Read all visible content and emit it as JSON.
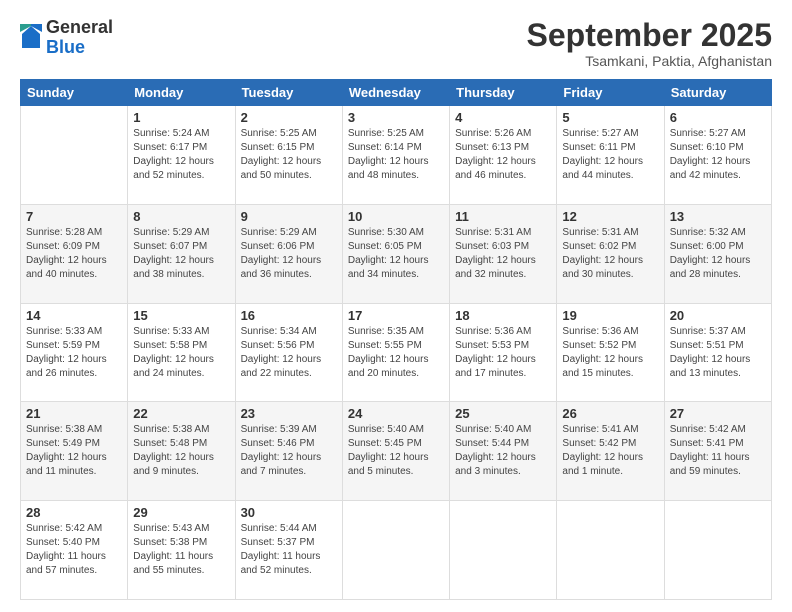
{
  "logo": {
    "general": "General",
    "blue": "Blue"
  },
  "title": "September 2025",
  "subtitle": "Tsamkani, Paktia, Afghanistan",
  "headers": [
    "Sunday",
    "Monday",
    "Tuesday",
    "Wednesday",
    "Thursday",
    "Friday",
    "Saturday"
  ],
  "weeks": [
    [
      {
        "day": "",
        "sunrise": "",
        "sunset": "",
        "daylight": ""
      },
      {
        "day": "1",
        "sunrise": "Sunrise: 5:24 AM",
        "sunset": "Sunset: 6:17 PM",
        "daylight": "Daylight: 12 hours and 52 minutes."
      },
      {
        "day": "2",
        "sunrise": "Sunrise: 5:25 AM",
        "sunset": "Sunset: 6:15 PM",
        "daylight": "Daylight: 12 hours and 50 minutes."
      },
      {
        "day": "3",
        "sunrise": "Sunrise: 5:25 AM",
        "sunset": "Sunset: 6:14 PM",
        "daylight": "Daylight: 12 hours and 48 minutes."
      },
      {
        "day": "4",
        "sunrise": "Sunrise: 5:26 AM",
        "sunset": "Sunset: 6:13 PM",
        "daylight": "Daylight: 12 hours and 46 minutes."
      },
      {
        "day": "5",
        "sunrise": "Sunrise: 5:27 AM",
        "sunset": "Sunset: 6:11 PM",
        "daylight": "Daylight: 12 hours and 44 minutes."
      },
      {
        "day": "6",
        "sunrise": "Sunrise: 5:27 AM",
        "sunset": "Sunset: 6:10 PM",
        "daylight": "Daylight: 12 hours and 42 minutes."
      }
    ],
    [
      {
        "day": "7",
        "sunrise": "Sunrise: 5:28 AM",
        "sunset": "Sunset: 6:09 PM",
        "daylight": "Daylight: 12 hours and 40 minutes."
      },
      {
        "day": "8",
        "sunrise": "Sunrise: 5:29 AM",
        "sunset": "Sunset: 6:07 PM",
        "daylight": "Daylight: 12 hours and 38 minutes."
      },
      {
        "day": "9",
        "sunrise": "Sunrise: 5:29 AM",
        "sunset": "Sunset: 6:06 PM",
        "daylight": "Daylight: 12 hours and 36 minutes."
      },
      {
        "day": "10",
        "sunrise": "Sunrise: 5:30 AM",
        "sunset": "Sunset: 6:05 PM",
        "daylight": "Daylight: 12 hours and 34 minutes."
      },
      {
        "day": "11",
        "sunrise": "Sunrise: 5:31 AM",
        "sunset": "Sunset: 6:03 PM",
        "daylight": "Daylight: 12 hours and 32 minutes."
      },
      {
        "day": "12",
        "sunrise": "Sunrise: 5:31 AM",
        "sunset": "Sunset: 6:02 PM",
        "daylight": "Daylight: 12 hours and 30 minutes."
      },
      {
        "day": "13",
        "sunrise": "Sunrise: 5:32 AM",
        "sunset": "Sunset: 6:00 PM",
        "daylight": "Daylight: 12 hours and 28 minutes."
      }
    ],
    [
      {
        "day": "14",
        "sunrise": "Sunrise: 5:33 AM",
        "sunset": "Sunset: 5:59 PM",
        "daylight": "Daylight: 12 hours and 26 minutes."
      },
      {
        "day": "15",
        "sunrise": "Sunrise: 5:33 AM",
        "sunset": "Sunset: 5:58 PM",
        "daylight": "Daylight: 12 hours and 24 minutes."
      },
      {
        "day": "16",
        "sunrise": "Sunrise: 5:34 AM",
        "sunset": "Sunset: 5:56 PM",
        "daylight": "Daylight: 12 hours and 22 minutes."
      },
      {
        "day": "17",
        "sunrise": "Sunrise: 5:35 AM",
        "sunset": "Sunset: 5:55 PM",
        "daylight": "Daylight: 12 hours and 20 minutes."
      },
      {
        "day": "18",
        "sunrise": "Sunrise: 5:36 AM",
        "sunset": "Sunset: 5:53 PM",
        "daylight": "Daylight: 12 hours and 17 minutes."
      },
      {
        "day": "19",
        "sunrise": "Sunrise: 5:36 AM",
        "sunset": "Sunset: 5:52 PM",
        "daylight": "Daylight: 12 hours and 15 minutes."
      },
      {
        "day": "20",
        "sunrise": "Sunrise: 5:37 AM",
        "sunset": "Sunset: 5:51 PM",
        "daylight": "Daylight: 12 hours and 13 minutes."
      }
    ],
    [
      {
        "day": "21",
        "sunrise": "Sunrise: 5:38 AM",
        "sunset": "Sunset: 5:49 PM",
        "daylight": "Daylight: 12 hours and 11 minutes."
      },
      {
        "day": "22",
        "sunrise": "Sunrise: 5:38 AM",
        "sunset": "Sunset: 5:48 PM",
        "daylight": "Daylight: 12 hours and 9 minutes."
      },
      {
        "day": "23",
        "sunrise": "Sunrise: 5:39 AM",
        "sunset": "Sunset: 5:46 PM",
        "daylight": "Daylight: 12 hours and 7 minutes."
      },
      {
        "day": "24",
        "sunrise": "Sunrise: 5:40 AM",
        "sunset": "Sunset: 5:45 PM",
        "daylight": "Daylight: 12 hours and 5 minutes."
      },
      {
        "day": "25",
        "sunrise": "Sunrise: 5:40 AM",
        "sunset": "Sunset: 5:44 PM",
        "daylight": "Daylight: 12 hours and 3 minutes."
      },
      {
        "day": "26",
        "sunrise": "Sunrise: 5:41 AM",
        "sunset": "Sunset: 5:42 PM",
        "daylight": "Daylight: 12 hours and 1 minute."
      },
      {
        "day": "27",
        "sunrise": "Sunrise: 5:42 AM",
        "sunset": "Sunset: 5:41 PM",
        "daylight": "Daylight: 11 hours and 59 minutes."
      }
    ],
    [
      {
        "day": "28",
        "sunrise": "Sunrise: 5:42 AM",
        "sunset": "Sunset: 5:40 PM",
        "daylight": "Daylight: 11 hours and 57 minutes."
      },
      {
        "day": "29",
        "sunrise": "Sunrise: 5:43 AM",
        "sunset": "Sunset: 5:38 PM",
        "daylight": "Daylight: 11 hours and 55 minutes."
      },
      {
        "day": "30",
        "sunrise": "Sunrise: 5:44 AM",
        "sunset": "Sunset: 5:37 PM",
        "daylight": "Daylight: 11 hours and 52 minutes."
      },
      {
        "day": "",
        "sunrise": "",
        "sunset": "",
        "daylight": ""
      },
      {
        "day": "",
        "sunrise": "",
        "sunset": "",
        "daylight": ""
      },
      {
        "day": "",
        "sunrise": "",
        "sunset": "",
        "daylight": ""
      },
      {
        "day": "",
        "sunrise": "",
        "sunset": "",
        "daylight": ""
      }
    ]
  ]
}
